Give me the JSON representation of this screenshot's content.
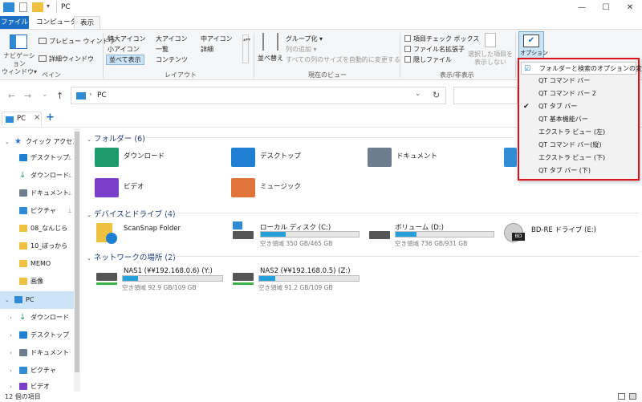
{
  "window": {
    "title": "PC",
    "minimize": "—",
    "maximize": "☐",
    "close": "✕"
  },
  "ribbon_tabs": [
    "ファイル",
    "コンピューター",
    "表示"
  ],
  "ribbon": {
    "pane": {
      "nav_pane": "ナビゲーション\nウィンドウ▾",
      "preview": "プレビュー ウィンドウ",
      "details": "詳細ウィンドウ",
      "group": "ペイン"
    },
    "layout": {
      "items": [
        "特大アイコン",
        "大アイコン",
        "中アイコン",
        "小アイコン",
        "一覧",
        "詳細",
        "並べて表示",
        "コンテンツ"
      ],
      "group": "レイアウト"
    },
    "current_view": {
      "sort": "並べ替え",
      "group_by": "グループ化 ▾",
      "add_column": "列の追加 ▾",
      "fit_columns": "すべての列のサイズを自動的に変更する",
      "group": "現在のビュー"
    },
    "show_hide": {
      "item_checkbox": "項目チェック ボックス",
      "file_ext": "ファイル名拡張子",
      "hidden_files": "隠しファイル",
      "hide_selected": "選択した項目を\n表示しない",
      "group": "表示/非表示"
    },
    "options": "オプション"
  },
  "nav": {
    "back": "←",
    "forward": "→",
    "recent": "⌄",
    "up": "↑",
    "address": "PC",
    "address_sep": "›",
    "dropdown": "⌄",
    "refresh": "↻"
  },
  "tabbar": {
    "tab": "PC",
    "close": "×",
    "add": "+"
  },
  "sidebar": {
    "items": [
      {
        "label": "クイック アクセス",
        "color": "#2b6fd6"
      },
      {
        "label": "デスクトップ",
        "color": "#1f7fd0",
        "pin": "📌"
      },
      {
        "label": "ダウンロード",
        "color": "#1f9c6e",
        "pin": "📌"
      },
      {
        "label": "ドキュメント",
        "color": "#6d7c8f",
        "pin": "📌"
      },
      {
        "label": "ピクチャ",
        "color": "#2f8bd6",
        "pin": "📌"
      },
      {
        "label": "08_なんじら",
        "color": "#f0c040"
      },
      {
        "label": "10_ぼっから",
        "color": "#f0c040"
      },
      {
        "label": "MEMO",
        "color": "#f0c040"
      },
      {
        "label": "画像",
        "color": "#f0c040"
      },
      {
        "label": "PC",
        "color": "#2f8bd6"
      },
      {
        "label": "ダウンロード",
        "color": "#1f9c6e"
      },
      {
        "label": "デスクトップ",
        "color": "#1f7fd0"
      },
      {
        "label": "ドキュメント",
        "color": "#6d7c8f"
      },
      {
        "label": "ピクチャ",
        "color": "#2f8bd6"
      },
      {
        "label": "ビデオ",
        "color": "#7b3fc9"
      }
    ]
  },
  "content": {
    "folders_header": "フォルダー (6)",
    "folders": [
      {
        "name": "ダウンロード",
        "color": "#1f9c6e"
      },
      {
        "name": "デスクトップ",
        "color": "#1f7fd0"
      },
      {
        "name": "ドキュメント",
        "color": "#6d7c8f"
      },
      {
        "name": "ビデオ",
        "color": "#7b3fc9"
      },
      {
        "name": "ミュージック",
        "color": "#e0743a"
      }
    ],
    "drives_header": "デバイスとドライブ (4)",
    "drives": [
      {
        "name": "ScanSnap Folder",
        "sub": ""
      },
      {
        "name": "ローカル ディスク (C:)",
        "sub": "空き領域 350 GB/465 GB",
        "used": 0.25
      },
      {
        "name": "ボリューム (D:)",
        "sub": "空き領域 736 GB/931 GB",
        "used": 0.21
      },
      {
        "name": "BD-RE ドライブ (E:)",
        "sub": ""
      }
    ],
    "network_header": "ネットワークの場所 (2)",
    "network": [
      {
        "name": "NAS1 (¥¥192.168.0.6) (Y:)",
        "sub": "空き領域 92.9 GB/109 GB",
        "used": 0.15
      },
      {
        "name": "NAS2 (¥¥192.168.0.5) (Z:)",
        "sub": "空き領域 91.2 GB/109 GB",
        "used": 0.16
      }
    ]
  },
  "status": {
    "count": "12 個の項目"
  },
  "options_menu": {
    "items": [
      {
        "label": "フォルダーと検索のオプションの変更(O)",
        "checked": "☑"
      },
      {
        "label": "QT コマンド バー",
        "checked": ""
      },
      {
        "label": "QT コマンド バー 2",
        "checked": ""
      },
      {
        "label": "QT タブ バー",
        "checked": "✔"
      },
      {
        "label": "QT 基本機能バー",
        "checked": ""
      },
      {
        "label": "エクストラ ビュー (左)",
        "checked": ""
      },
      {
        "label": "QT コマンド バー(縦)",
        "checked": ""
      },
      {
        "label": "エクストラ ビュー (下)",
        "checked": ""
      },
      {
        "label": "QT タブ バー (下)",
        "checked": ""
      }
    ]
  }
}
